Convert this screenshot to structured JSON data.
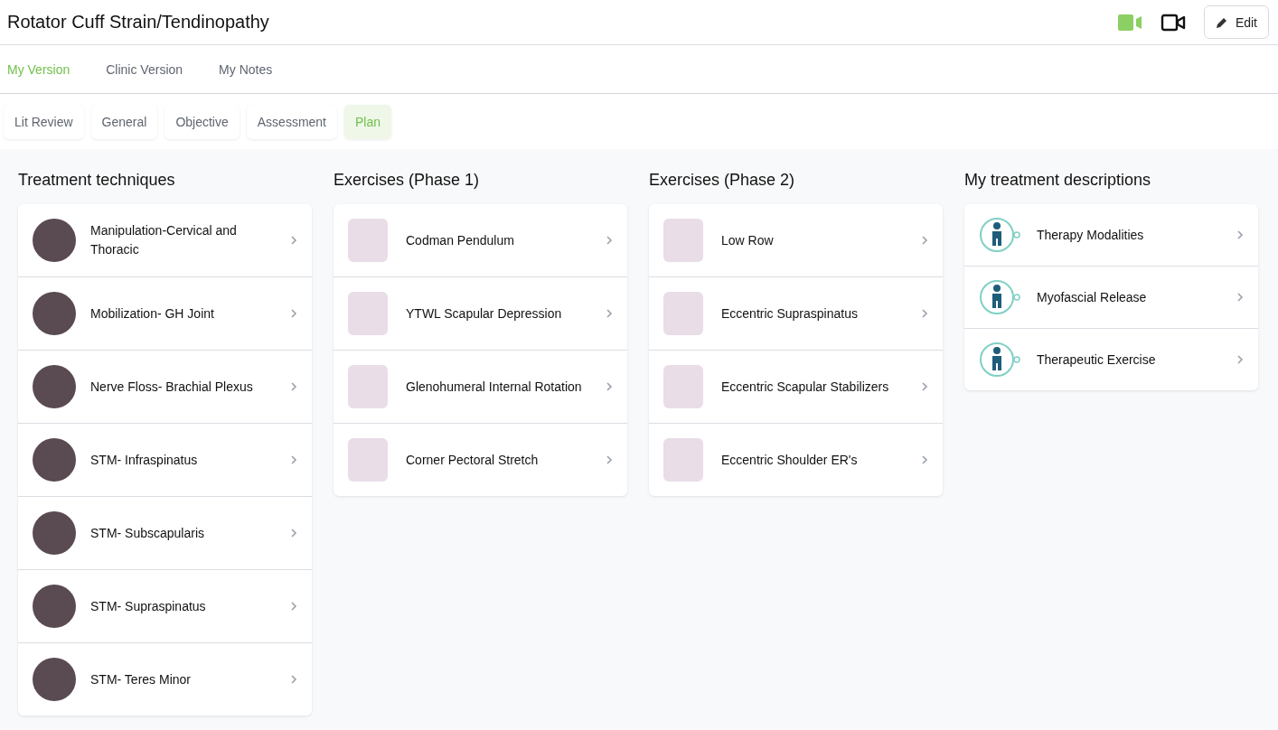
{
  "header": {
    "title": "Rotator Cuff Strain/Tendinopathy",
    "edit_button": "Edit"
  },
  "version_tabs": [
    {
      "label": "My Version",
      "selected": true
    },
    {
      "label": "Clinic Version",
      "selected": false
    },
    {
      "label": "My Notes",
      "selected": false
    }
  ],
  "section_tabs": [
    {
      "label": "Lit Review",
      "selected": false
    },
    {
      "label": "General",
      "selected": false
    },
    {
      "label": "Objective",
      "selected": false
    },
    {
      "label": "Assessment",
      "selected": false
    },
    {
      "label": "Plan",
      "selected": true
    }
  ],
  "columns": [
    {
      "title": "Treatment techniques",
      "items": [
        {
          "kind": "photo",
          "label": "Manipulation-Cervical and Thoracic"
        },
        {
          "kind": "photo",
          "label": "Mobilization- GH Joint"
        },
        {
          "kind": "photo",
          "label": "Nerve Floss- Brachial Plexus"
        },
        {
          "kind": "photo",
          "label": "STM- Infraspinatus"
        },
        {
          "kind": "photo",
          "label": "STM- Subscapularis"
        },
        {
          "kind": "photo",
          "label": "STM- Supraspinatus"
        },
        {
          "kind": "photo",
          "label": "STM- Teres Minor"
        }
      ]
    },
    {
      "title": "Exercises (Phase 1)",
      "items": [
        {
          "kind": "exercise",
          "label": "Codman Pendulum"
        },
        {
          "kind": "exercise",
          "label": "YTWL Scapular Depression"
        },
        {
          "kind": "exercise",
          "label": "Glenohumeral Internal Rotation"
        },
        {
          "kind": "exercise",
          "label": "Corner Pectoral Stretch"
        }
      ]
    },
    {
      "title": "Exercises (Phase 2)",
      "items": [
        {
          "kind": "exercise",
          "label": "Low Row"
        },
        {
          "kind": "exercise",
          "label": "Eccentric Supraspinatus"
        },
        {
          "kind": "exercise",
          "label": "Eccentric Scapular Stabilizers"
        },
        {
          "kind": "exercise",
          "label": "Eccentric Shoulder ER's"
        }
      ]
    },
    {
      "title": "My treatment descriptions",
      "items": [
        {
          "kind": "icon",
          "label": "Therapy Modalities"
        },
        {
          "kind": "icon",
          "label": "Myofascial Release"
        },
        {
          "kind": "icon",
          "label": "Therapeutic Exercise"
        }
      ]
    }
  ]
}
